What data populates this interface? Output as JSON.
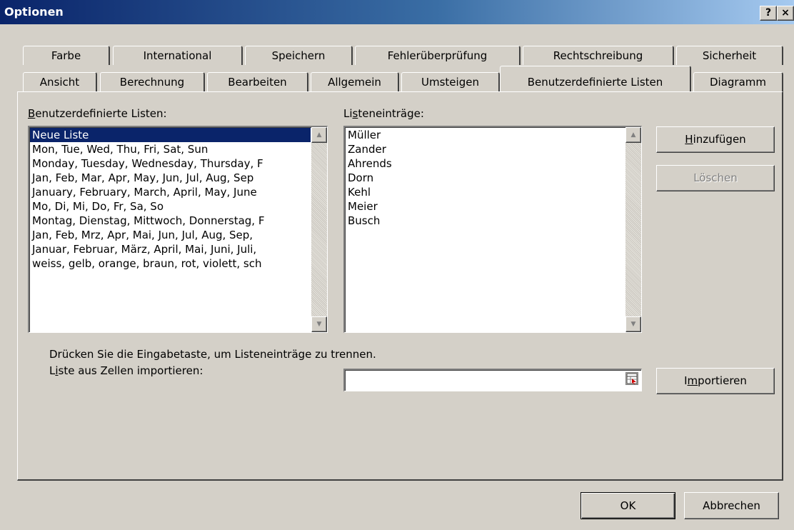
{
  "window": {
    "title": "Optionen",
    "help_label": "?",
    "close_label": "×"
  },
  "tabs": {
    "row1": [
      "Farbe",
      "International",
      "Speichern",
      "Fehlerüberprüfung",
      "Rechtschreibung",
      "Sicherheit"
    ],
    "row2": [
      "Ansicht",
      "Berechnung",
      "Bearbeiten",
      "Allgemein",
      "Umsteigen",
      "Benutzerdefinierte Listen",
      "Diagramm"
    ],
    "active": "Benutzerdefinierte Listen"
  },
  "custom_lists": {
    "label": "Benutzerdefinierte Listen:",
    "label_underline": "B",
    "label_rest": "enutzerdefinierte Listen:",
    "items": [
      "Neue Liste",
      "Mon, Tue, Wed, Thu, Fri, Sat, Sun",
      "Monday, Tuesday, Wednesday, Thursday, F",
      "Jan, Feb, Mar, Apr, May, Jun, Jul, Aug, Sep",
      "January, February, March, April, May, June",
      "Mo, Di, Mi, Do, Fr, Sa, So",
      "Montag, Dienstag, Mittwoch, Donnerstag, F",
      "Jan, Feb, Mrz, Apr, Mai, Jun, Jul, Aug, Sep,",
      "Januar, Februar, März, April, Mai, Juni, Juli,",
      "weiss, gelb, orange, braun, rot, violett, sch"
    ],
    "selected_index": 0
  },
  "list_entries": {
    "label_pre": "Li",
    "label_underline": "s",
    "label_post": "teneinträge:",
    "items": [
      "Müller",
      "Zander",
      "Ahrends",
      "Dorn",
      "Kehl",
      "Meier",
      "Busch"
    ]
  },
  "buttons": {
    "add_underline": "H",
    "add_rest": "inzufügen",
    "delete": "Löschen",
    "import_pre": "I",
    "import_underline": "m",
    "import_post": "portieren",
    "ok": "OK",
    "cancel": "Abbrechen"
  },
  "hint_text": "Drücken Sie die Eingabetaste, um Listeneinträge zu trennen.",
  "import": {
    "label_pre": "L",
    "label_underline": "i",
    "label_post": "ste aus Zellen importieren:",
    "value": ""
  },
  "icons": {
    "scroll_up": "scroll-up-arrow-icon",
    "scroll_down": "scroll-down-arrow-icon",
    "range_select": "range-select-icon"
  }
}
